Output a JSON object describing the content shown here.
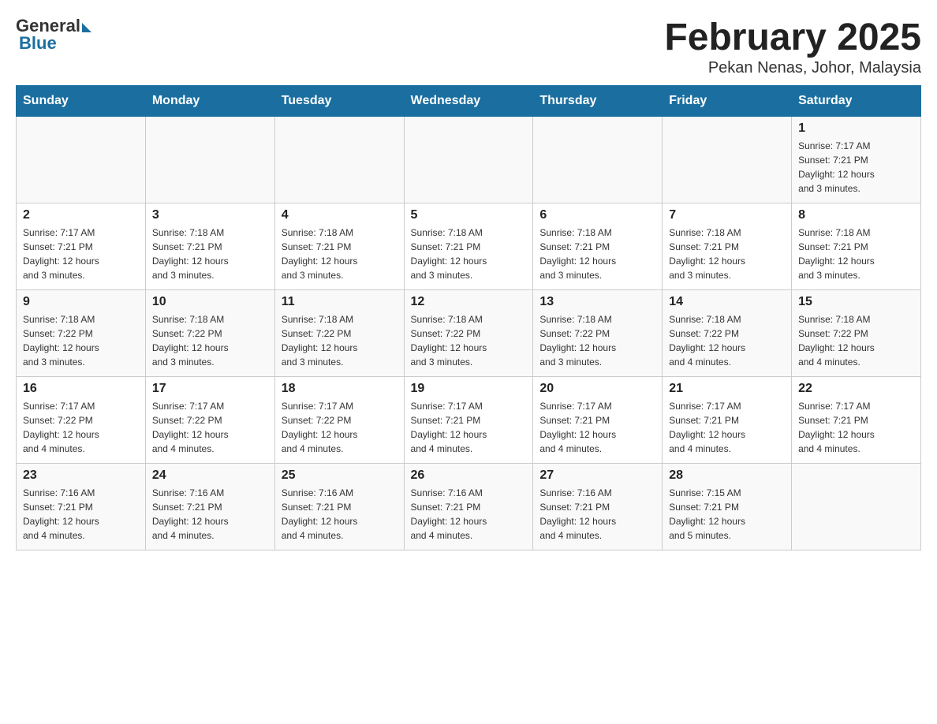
{
  "header": {
    "logo_general": "General",
    "logo_blue": "Blue",
    "month_title": "February 2025",
    "location": "Pekan Nenas, Johor, Malaysia"
  },
  "weekdays": [
    "Sunday",
    "Monday",
    "Tuesday",
    "Wednesday",
    "Thursday",
    "Friday",
    "Saturday"
  ],
  "weeks": [
    [
      {
        "day": "",
        "info": ""
      },
      {
        "day": "",
        "info": ""
      },
      {
        "day": "",
        "info": ""
      },
      {
        "day": "",
        "info": ""
      },
      {
        "day": "",
        "info": ""
      },
      {
        "day": "",
        "info": ""
      },
      {
        "day": "1",
        "info": "Sunrise: 7:17 AM\nSunset: 7:21 PM\nDaylight: 12 hours\nand 3 minutes."
      }
    ],
    [
      {
        "day": "2",
        "info": "Sunrise: 7:17 AM\nSunset: 7:21 PM\nDaylight: 12 hours\nand 3 minutes."
      },
      {
        "day": "3",
        "info": "Sunrise: 7:18 AM\nSunset: 7:21 PM\nDaylight: 12 hours\nand 3 minutes."
      },
      {
        "day": "4",
        "info": "Sunrise: 7:18 AM\nSunset: 7:21 PM\nDaylight: 12 hours\nand 3 minutes."
      },
      {
        "day": "5",
        "info": "Sunrise: 7:18 AM\nSunset: 7:21 PM\nDaylight: 12 hours\nand 3 minutes."
      },
      {
        "day": "6",
        "info": "Sunrise: 7:18 AM\nSunset: 7:21 PM\nDaylight: 12 hours\nand 3 minutes."
      },
      {
        "day": "7",
        "info": "Sunrise: 7:18 AM\nSunset: 7:21 PM\nDaylight: 12 hours\nand 3 minutes."
      },
      {
        "day": "8",
        "info": "Sunrise: 7:18 AM\nSunset: 7:21 PM\nDaylight: 12 hours\nand 3 minutes."
      }
    ],
    [
      {
        "day": "9",
        "info": "Sunrise: 7:18 AM\nSunset: 7:22 PM\nDaylight: 12 hours\nand 3 minutes."
      },
      {
        "day": "10",
        "info": "Sunrise: 7:18 AM\nSunset: 7:22 PM\nDaylight: 12 hours\nand 3 minutes."
      },
      {
        "day": "11",
        "info": "Sunrise: 7:18 AM\nSunset: 7:22 PM\nDaylight: 12 hours\nand 3 minutes."
      },
      {
        "day": "12",
        "info": "Sunrise: 7:18 AM\nSunset: 7:22 PM\nDaylight: 12 hours\nand 3 minutes."
      },
      {
        "day": "13",
        "info": "Sunrise: 7:18 AM\nSunset: 7:22 PM\nDaylight: 12 hours\nand 3 minutes."
      },
      {
        "day": "14",
        "info": "Sunrise: 7:18 AM\nSunset: 7:22 PM\nDaylight: 12 hours\nand 4 minutes."
      },
      {
        "day": "15",
        "info": "Sunrise: 7:18 AM\nSunset: 7:22 PM\nDaylight: 12 hours\nand 4 minutes."
      }
    ],
    [
      {
        "day": "16",
        "info": "Sunrise: 7:17 AM\nSunset: 7:22 PM\nDaylight: 12 hours\nand 4 minutes."
      },
      {
        "day": "17",
        "info": "Sunrise: 7:17 AM\nSunset: 7:22 PM\nDaylight: 12 hours\nand 4 minutes."
      },
      {
        "day": "18",
        "info": "Sunrise: 7:17 AM\nSunset: 7:22 PM\nDaylight: 12 hours\nand 4 minutes."
      },
      {
        "day": "19",
        "info": "Sunrise: 7:17 AM\nSunset: 7:21 PM\nDaylight: 12 hours\nand 4 minutes."
      },
      {
        "day": "20",
        "info": "Sunrise: 7:17 AM\nSunset: 7:21 PM\nDaylight: 12 hours\nand 4 minutes."
      },
      {
        "day": "21",
        "info": "Sunrise: 7:17 AM\nSunset: 7:21 PM\nDaylight: 12 hours\nand 4 minutes."
      },
      {
        "day": "22",
        "info": "Sunrise: 7:17 AM\nSunset: 7:21 PM\nDaylight: 12 hours\nand 4 minutes."
      }
    ],
    [
      {
        "day": "23",
        "info": "Sunrise: 7:16 AM\nSunset: 7:21 PM\nDaylight: 12 hours\nand 4 minutes."
      },
      {
        "day": "24",
        "info": "Sunrise: 7:16 AM\nSunset: 7:21 PM\nDaylight: 12 hours\nand 4 minutes."
      },
      {
        "day": "25",
        "info": "Sunrise: 7:16 AM\nSunset: 7:21 PM\nDaylight: 12 hours\nand 4 minutes."
      },
      {
        "day": "26",
        "info": "Sunrise: 7:16 AM\nSunset: 7:21 PM\nDaylight: 12 hours\nand 4 minutes."
      },
      {
        "day": "27",
        "info": "Sunrise: 7:16 AM\nSunset: 7:21 PM\nDaylight: 12 hours\nand 4 minutes."
      },
      {
        "day": "28",
        "info": "Sunrise: 7:15 AM\nSunset: 7:21 PM\nDaylight: 12 hours\nand 5 minutes."
      },
      {
        "day": "",
        "info": ""
      }
    ]
  ]
}
